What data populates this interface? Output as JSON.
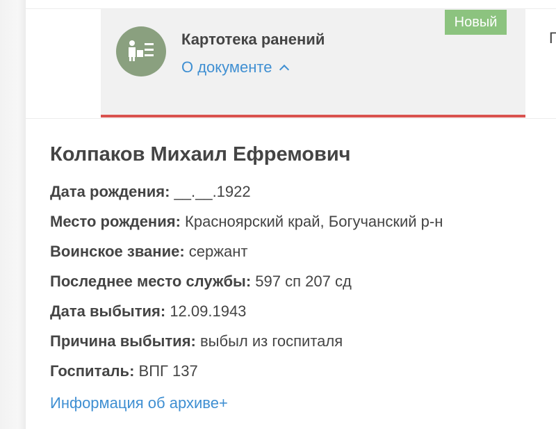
{
  "document": {
    "title": "Картотека ранений",
    "about_link": "О документе",
    "badge": "Новый",
    "right_cut_text": "П",
    "icon": "archive-card-icon"
  },
  "person": {
    "name": "Колпаков Михаил Ефремович",
    "fields": [
      {
        "label": "Дата рождения:",
        "value": "__.__.1922"
      },
      {
        "label": "Место рождения:",
        "value": "Красноярский край, Богучанский р-н"
      },
      {
        "label": "Воинское звание:",
        "value": "сержант"
      },
      {
        "label": "Последнее место службы:",
        "value": "597 сп 207 сд"
      },
      {
        "label": "Дата выбытия:",
        "value": "12.09.1943"
      },
      {
        "label": "Причина выбытия:",
        "value": "выбыл из госпиталя"
      },
      {
        "label": "Госпиталь:",
        "value": "ВПГ 137"
      }
    ]
  },
  "archive_link": "Информация об архиве+",
  "colors": {
    "accent_link": "#3f8fd2",
    "badge_bg": "#8cc37f",
    "icon_bg": "#8aa07f",
    "underline": "#d9534f"
  }
}
